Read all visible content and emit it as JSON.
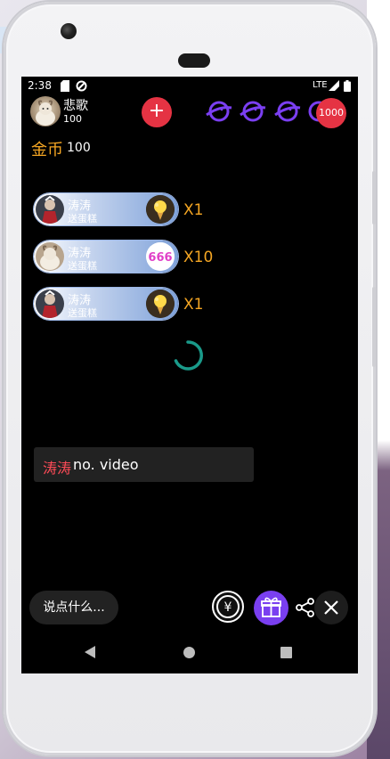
{
  "status_bar": {
    "time": "2:38",
    "network": "LTE",
    "icons": [
      "sd-card-icon",
      "data-saver-icon",
      "signal-icon",
      "battery-icon"
    ]
  },
  "host": {
    "name": "悲歌",
    "id_number": "100"
  },
  "follow_button_label": "+",
  "viewer_count": "1000",
  "coins": {
    "label": "金币",
    "value": "100"
  },
  "gift_feed": [
    {
      "sender": "涛涛",
      "action": "送蛋糕",
      "gift_icon": "ice-cream-icon",
      "count": "X1"
    },
    {
      "sender": "涛涛",
      "action": "送蛋糕",
      "gift_icon": "gift-666-icon",
      "gift_text": "666",
      "count": "X10"
    },
    {
      "sender": "涛涛",
      "action": "送蛋糕",
      "gift_icon": "ice-cream-icon",
      "count": "X1"
    }
  ],
  "chat": {
    "user": "涛涛",
    "message": "no. video"
  },
  "bottom_bar": {
    "comment_placeholder": "说点什么...",
    "coin_symbol": "¥"
  },
  "colors": {
    "accent_red": "#e53343",
    "coin_gold": "#f5a623",
    "gift_purple": "#7a3ff0",
    "planet_purple": "#7b3ff2",
    "spinner_teal": "#1a9a8a",
    "chat_user_red": "#ff4b57"
  }
}
